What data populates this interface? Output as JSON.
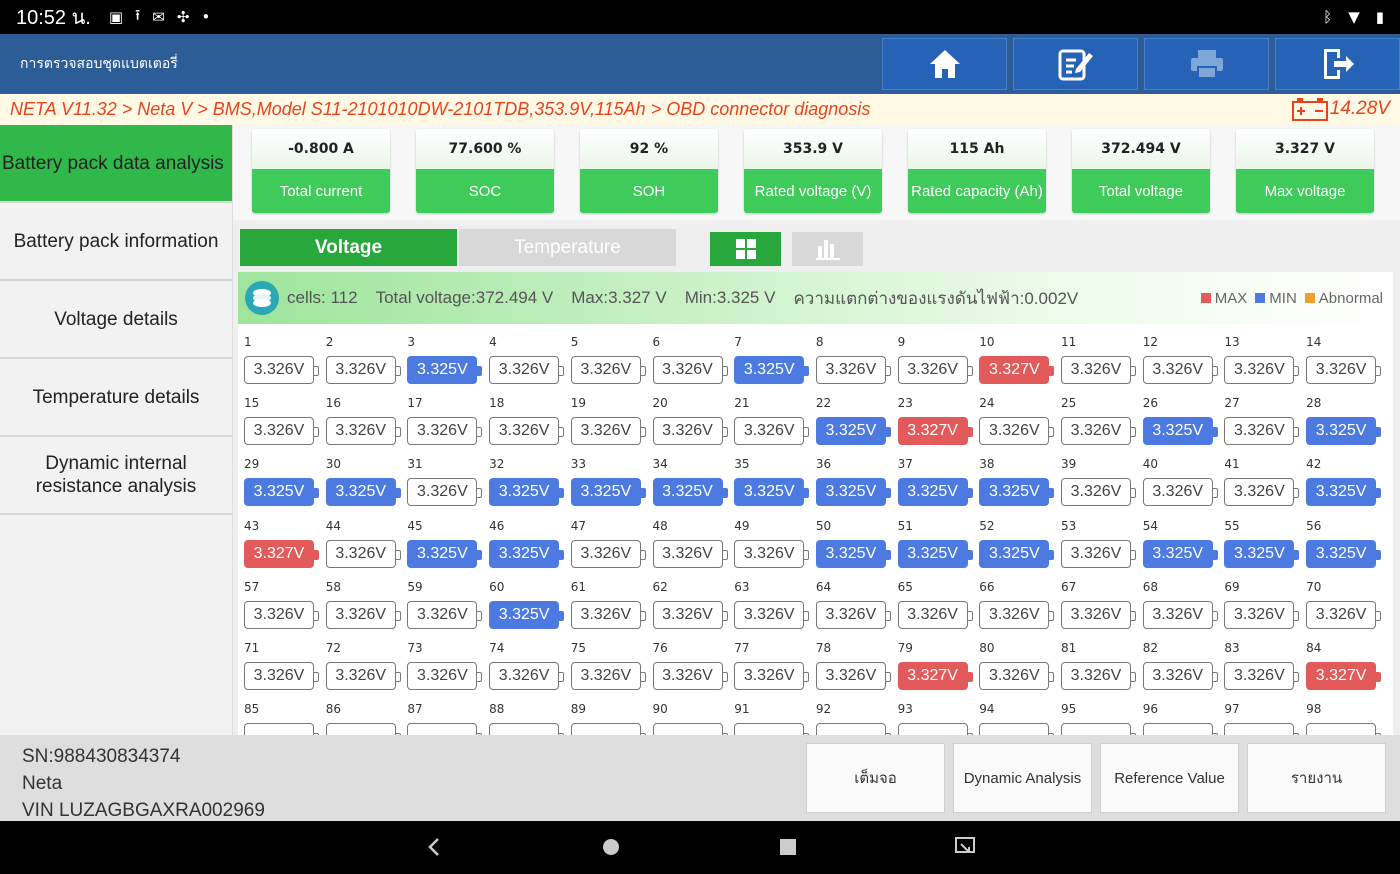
{
  "status_bar": {
    "time": "10:52 น."
  },
  "app": {
    "title": "การตรวจสอบชุดแบตเตอรี่"
  },
  "breadcrumb": {
    "text": "NETA V11.32 > Neta V  > BMS,Model S11-2101010DW-2101TDB,353.9V,115Ah > OBD connector diagnosis",
    "battery_voltage": "14.28V"
  },
  "sidebar": {
    "items": [
      {
        "label": "Battery pack data analysis"
      },
      {
        "label": "Battery pack information"
      },
      {
        "label": "Voltage details"
      },
      {
        "label": "Temperature details"
      },
      {
        "label": "Dynamic internal resistance analysis"
      }
    ]
  },
  "stats": [
    {
      "value": "-0.800 A",
      "label": "Total current"
    },
    {
      "value": "77.600 %",
      "label": "SOC"
    },
    {
      "value": "92 %",
      "label": "SOH"
    },
    {
      "value": "353.9 V",
      "label": "Rated voltage (V)"
    },
    {
      "value": "115 Ah",
      "label": "Rated capacity (Ah)"
    },
    {
      "value": "372.494 V",
      "label": "Total voltage"
    },
    {
      "value": "3.327 V",
      "label": "Max voltage"
    }
  ],
  "tabs": {
    "voltage": "Voltage",
    "temperature": "Temperature"
  },
  "summary": {
    "cells": "cells:  112",
    "total": "Total voltage:372.494 V",
    "max": "Max:3.327 V",
    "min": "Min:3.325 V",
    "diff": "ความแตกต่างของแรงดันไฟฟ้า:0.002V"
  },
  "legend": {
    "max": "MAX",
    "min": "MIN",
    "abnormal": "Abnormal"
  },
  "colors": {
    "max": "#e35a5a",
    "min": "#4c7ae0",
    "abnormal": "#f0a030",
    "accent": "#28a83c"
  },
  "cells": [
    {
      "n": "1",
      "v": "3.326V",
      "s": "n"
    },
    {
      "n": "2",
      "v": "3.326V",
      "s": "n"
    },
    {
      "n": "3",
      "v": "3.325V",
      "s": "min"
    },
    {
      "n": "4",
      "v": "3.326V",
      "s": "n"
    },
    {
      "n": "5",
      "v": "3.326V",
      "s": "n"
    },
    {
      "n": "6",
      "v": "3.326V",
      "s": "n"
    },
    {
      "n": "7",
      "v": "3.325V",
      "s": "min"
    },
    {
      "n": "8",
      "v": "3.326V",
      "s": "n"
    },
    {
      "n": "9",
      "v": "3.326V",
      "s": "n"
    },
    {
      "n": "10",
      "v": "3.327V",
      "s": "max"
    },
    {
      "n": "11",
      "v": "3.326V",
      "s": "n"
    },
    {
      "n": "12",
      "v": "3.326V",
      "s": "n"
    },
    {
      "n": "13",
      "v": "3.326V",
      "s": "n"
    },
    {
      "n": "14",
      "v": "3.326V",
      "s": "n"
    },
    {
      "n": "15",
      "v": "3.326V",
      "s": "n"
    },
    {
      "n": "16",
      "v": "3.326V",
      "s": "n"
    },
    {
      "n": "17",
      "v": "3.326V",
      "s": "n"
    },
    {
      "n": "18",
      "v": "3.326V",
      "s": "n"
    },
    {
      "n": "19",
      "v": "3.326V",
      "s": "n"
    },
    {
      "n": "20",
      "v": "3.326V",
      "s": "n"
    },
    {
      "n": "21",
      "v": "3.326V",
      "s": "n"
    },
    {
      "n": "22",
      "v": "3.325V",
      "s": "min"
    },
    {
      "n": "23",
      "v": "3.327V",
      "s": "max"
    },
    {
      "n": "24",
      "v": "3.326V",
      "s": "n"
    },
    {
      "n": "25",
      "v": "3.326V",
      "s": "n"
    },
    {
      "n": "26",
      "v": "3.325V",
      "s": "min"
    },
    {
      "n": "27",
      "v": "3.326V",
      "s": "n"
    },
    {
      "n": "28",
      "v": "3.325V",
      "s": "min"
    },
    {
      "n": "29",
      "v": "3.325V",
      "s": "min"
    },
    {
      "n": "30",
      "v": "3.325V",
      "s": "min"
    },
    {
      "n": "31",
      "v": "3.326V",
      "s": "n"
    },
    {
      "n": "32",
      "v": "3.325V",
      "s": "min"
    },
    {
      "n": "33",
      "v": "3.325V",
      "s": "min"
    },
    {
      "n": "34",
      "v": "3.325V",
      "s": "min"
    },
    {
      "n": "35",
      "v": "3.325V",
      "s": "min"
    },
    {
      "n": "36",
      "v": "3.325V",
      "s": "min"
    },
    {
      "n": "37",
      "v": "3.325V",
      "s": "min"
    },
    {
      "n": "38",
      "v": "3.325V",
      "s": "min"
    },
    {
      "n": "39",
      "v": "3.326V",
      "s": "n"
    },
    {
      "n": "40",
      "v": "3.326V",
      "s": "n"
    },
    {
      "n": "41",
      "v": "3.326V",
      "s": "n"
    },
    {
      "n": "42",
      "v": "3.325V",
      "s": "min"
    },
    {
      "n": "43",
      "v": "3.327V",
      "s": "max"
    },
    {
      "n": "44",
      "v": "3.326V",
      "s": "n"
    },
    {
      "n": "45",
      "v": "3.325V",
      "s": "min"
    },
    {
      "n": "46",
      "v": "3.325V",
      "s": "min"
    },
    {
      "n": "47",
      "v": "3.326V",
      "s": "n"
    },
    {
      "n": "48",
      "v": "3.326V",
      "s": "n"
    },
    {
      "n": "49",
      "v": "3.326V",
      "s": "n"
    },
    {
      "n": "50",
      "v": "3.325V",
      "s": "min"
    },
    {
      "n": "51",
      "v": "3.325V",
      "s": "min"
    },
    {
      "n": "52",
      "v": "3.325V",
      "s": "min"
    },
    {
      "n": "53",
      "v": "3.326V",
      "s": "n"
    },
    {
      "n": "54",
      "v": "3.325V",
      "s": "min"
    },
    {
      "n": "55",
      "v": "3.325V",
      "s": "min"
    },
    {
      "n": "56",
      "v": "3.325V",
      "s": "min"
    },
    {
      "n": "57",
      "v": "3.326V",
      "s": "n"
    },
    {
      "n": "58",
      "v": "3.326V",
      "s": "n"
    },
    {
      "n": "59",
      "v": "3.326V",
      "s": "n"
    },
    {
      "n": "60",
      "v": "3.325V",
      "s": "min"
    },
    {
      "n": "61",
      "v": "3.326V",
      "s": "n"
    },
    {
      "n": "62",
      "v": "3.326V",
      "s": "n"
    },
    {
      "n": "63",
      "v": "3.326V",
      "s": "n"
    },
    {
      "n": "64",
      "v": "3.326V",
      "s": "n"
    },
    {
      "n": "65",
      "v": "3.326V",
      "s": "n"
    },
    {
      "n": "66",
      "v": "3.326V",
      "s": "n"
    },
    {
      "n": "67",
      "v": "3.326V",
      "s": "n"
    },
    {
      "n": "68",
      "v": "3.326V",
      "s": "n"
    },
    {
      "n": "69",
      "v": "3.326V",
      "s": "n"
    },
    {
      "n": "70",
      "v": "3.326V",
      "s": "n"
    },
    {
      "n": "71",
      "v": "3.326V",
      "s": "n"
    },
    {
      "n": "72",
      "v": "3.326V",
      "s": "n"
    },
    {
      "n": "73",
      "v": "3.326V",
      "s": "n"
    },
    {
      "n": "74",
      "v": "3.326V",
      "s": "n"
    },
    {
      "n": "75",
      "v": "3.326V",
      "s": "n"
    },
    {
      "n": "76",
      "v": "3.326V",
      "s": "n"
    },
    {
      "n": "77",
      "v": "3.326V",
      "s": "n"
    },
    {
      "n": "78",
      "v": "3.326V",
      "s": "n"
    },
    {
      "n": "79",
      "v": "3.327V",
      "s": "max"
    },
    {
      "n": "80",
      "v": "3.326V",
      "s": "n"
    },
    {
      "n": "81",
      "v": "3.326V",
      "s": "n"
    },
    {
      "n": "82",
      "v": "3.326V",
      "s": "n"
    },
    {
      "n": "83",
      "v": "3.326V",
      "s": "n"
    },
    {
      "n": "84",
      "v": "3.327V",
      "s": "max"
    },
    {
      "n": "85",
      "v": "",
      "s": "n"
    },
    {
      "n": "86",
      "v": "",
      "s": "n"
    },
    {
      "n": "87",
      "v": "",
      "s": "n"
    },
    {
      "n": "88",
      "v": "",
      "s": "n"
    },
    {
      "n": "89",
      "v": "",
      "s": "n"
    },
    {
      "n": "90",
      "v": "",
      "s": "n"
    },
    {
      "n": "91",
      "v": "",
      "s": "n"
    },
    {
      "n": "92",
      "v": "",
      "s": "n"
    },
    {
      "n": "93",
      "v": "",
      "s": "n"
    },
    {
      "n": "94",
      "v": "",
      "s": "n"
    },
    {
      "n": "95",
      "v": "",
      "s": "n"
    },
    {
      "n": "96",
      "v": "",
      "s": "n"
    },
    {
      "n": "97",
      "v": "",
      "s": "n"
    },
    {
      "n": "98",
      "v": "",
      "s": "n"
    }
  ],
  "footer": {
    "sn": "SN:988430834374",
    "make": "Neta",
    "vin": "VIN LUZAGBGAXRA002969",
    "buttons": [
      "เต็มจอ",
      "Dynamic Analysis",
      "Reference Value",
      "รายงาน"
    ]
  }
}
